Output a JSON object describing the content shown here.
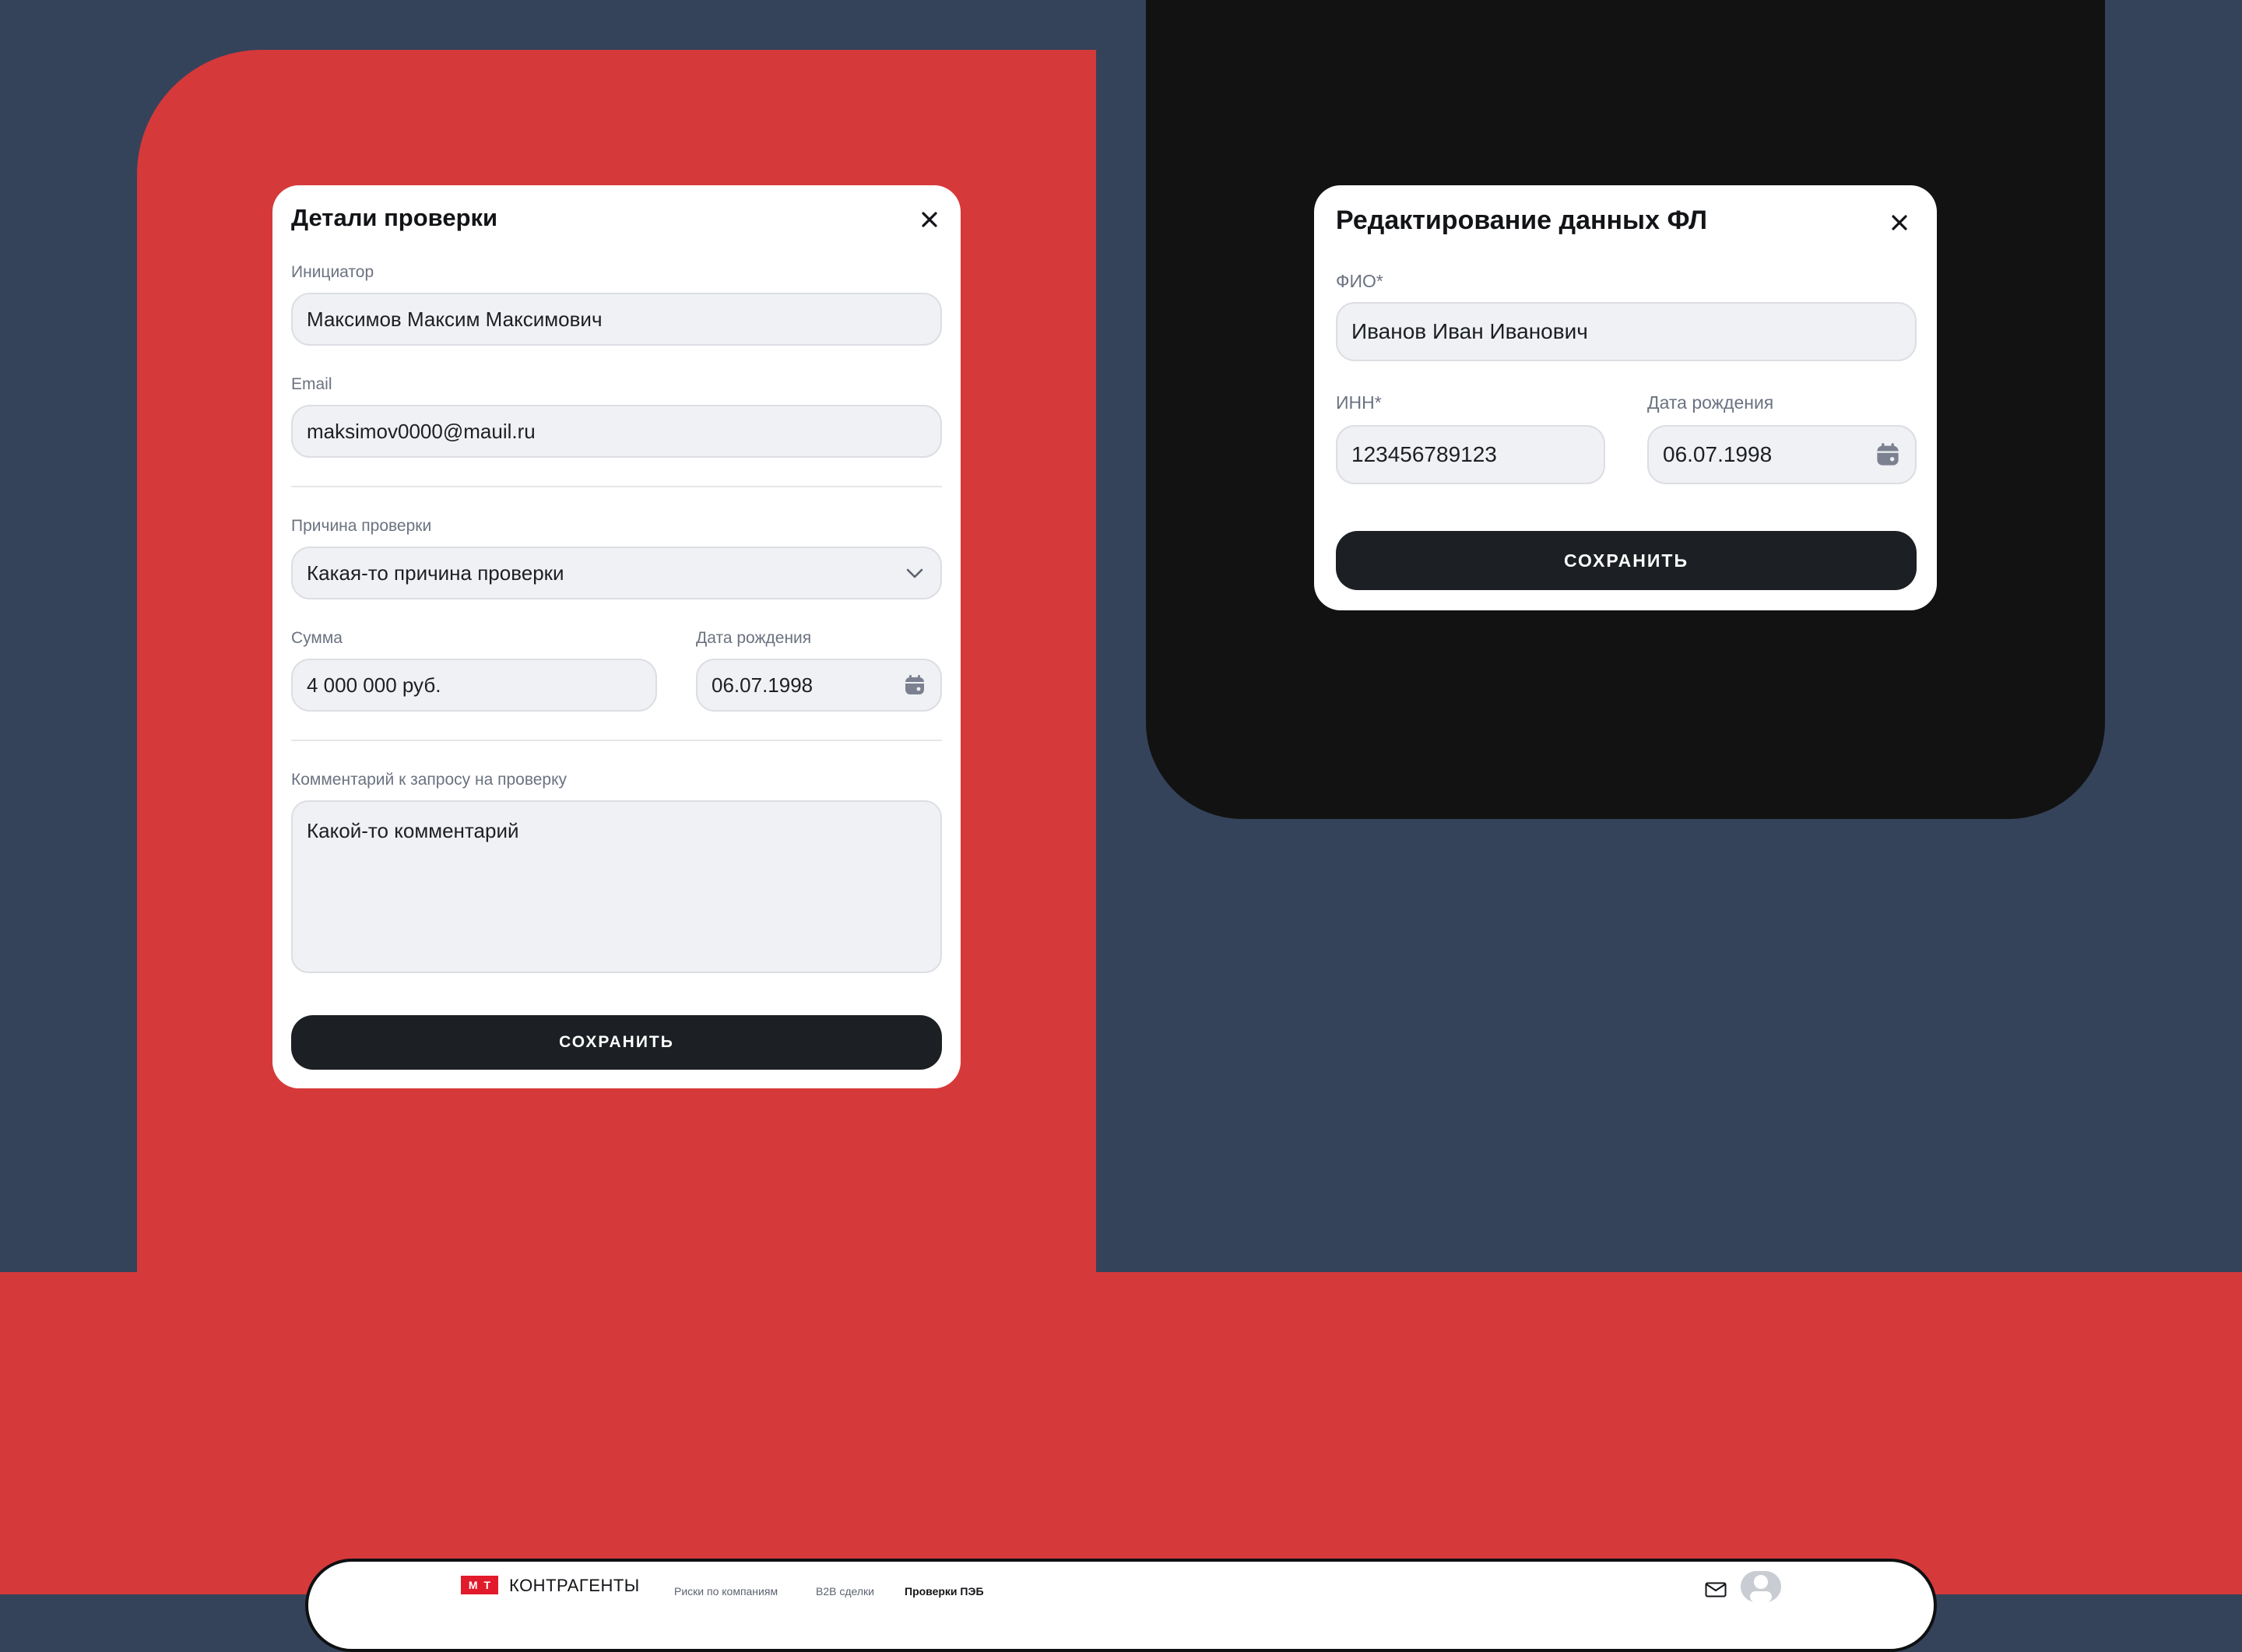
{
  "modal_check": {
    "title": "Детали проверки",
    "initiator_label": "Инициатор",
    "initiator_value": "Максимов Максим Максимович",
    "email_label": "Email",
    "email_value": "maksimov0000@mauil.ru",
    "reason_label": "Причина проверки",
    "reason_value": "Какая-то причина проверки",
    "amount_label": "Сумма",
    "amount_value": "4 000 000 руб.",
    "birth_label": "Дата рождения",
    "birth_value": "06.07.1998",
    "comment_label": "Комментарий к запросу на проверку",
    "comment_value": "Какой-то комментарий",
    "save_label": "СОХРАНИТЬ"
  },
  "modal_person": {
    "title": "Редактирование данных ФЛ",
    "fio_label": "ФИО*",
    "fio_value": "Иванов Иван Иванович",
    "inn_label": "ИНН*",
    "inn_value": "123456789123",
    "birth_label": "Дата рождения",
    "birth_value": "06.07.1998",
    "save_label": "СОХРАНИТЬ"
  },
  "header": {
    "logo_letters": [
      "М",
      "Т"
    ],
    "logo_text": "КОНТРАГЕНТЫ",
    "nav": [
      {
        "label": "Риски по компаниям",
        "active": false
      },
      {
        "label": "B2B сделки",
        "active": false
      },
      {
        "label": "Проверки ПЭБ",
        "active": true
      }
    ]
  },
  "icons": {
    "close": "close-icon",
    "chevron": "chevron-down-icon",
    "calendar": "calendar-icon",
    "mail": "mail-icon",
    "avatar": "avatar-icon"
  },
  "colors": {
    "accent_red": "#d6393a",
    "navy_bg": "#34435a",
    "dark_panel": "#121212",
    "button_dark": "#1c1f23",
    "logo_red": "#e11b2c"
  }
}
